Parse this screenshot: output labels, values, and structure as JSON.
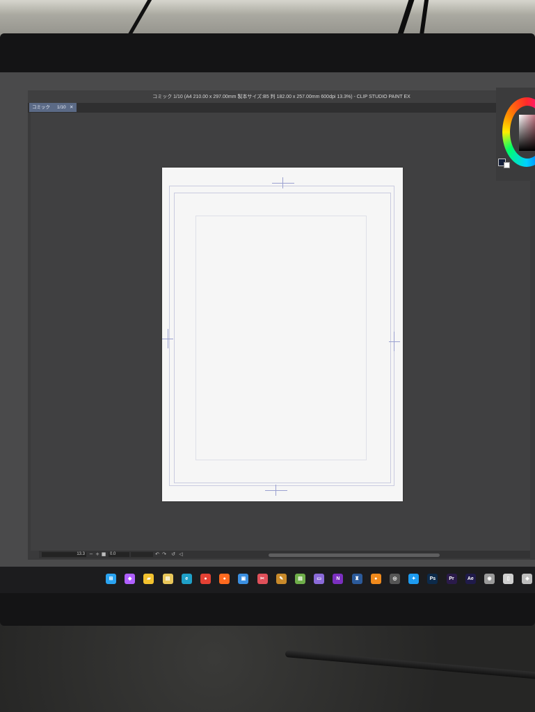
{
  "window": {
    "title": "コミック 1/10 (A4 210.00 x 297.00mm 製本サイズ:B5 判 182.00 x 257.00mm 600dpi 13.3%) - CLIP STUDIO PAINT EX"
  },
  "tab": {
    "name": "コミック",
    "page": "1/10",
    "close": "✕"
  },
  "statusbar": {
    "zoom": "13.3",
    "zoom_out": "−",
    "zoom_in": "+",
    "angle": "0.0"
  },
  "colors": {
    "main_color": "#15203a",
    "sub_color": "#ffffff"
  },
  "taskbar": {
    "icons": [
      {
        "name": "windows-start-icon",
        "glyph": "⊞",
        "color": "#2aa3f0"
      },
      {
        "name": "copilot-icon",
        "glyph": "◆",
        "color": "#b060ff"
      },
      {
        "name": "file-explorer-icon",
        "glyph": "▰",
        "color": "#f2c12e"
      },
      {
        "name": "sticky-notes-icon",
        "glyph": "▤",
        "color": "#e8c65a"
      },
      {
        "name": "edge-icon",
        "glyph": "e",
        "color": "#1fa0c8"
      },
      {
        "name": "chrome-icon",
        "glyph": "●",
        "color": "#e44134"
      },
      {
        "name": "firefox-icon",
        "glyph": "●",
        "color": "#ff6a1f"
      },
      {
        "name": "remote-desktop-icon",
        "glyph": "▣",
        "color": "#3b8fe0"
      },
      {
        "name": "snipping-tool-icon",
        "glyph": "✂",
        "color": "#e0505a"
      },
      {
        "name": "clip-studio-icon",
        "glyph": "✎",
        "color": "#c98a2a"
      },
      {
        "name": "notepad-icon",
        "glyph": "▤",
        "color": "#6fae4a"
      },
      {
        "name": "display-icon",
        "glyph": "▭",
        "color": "#8a6ad8"
      },
      {
        "name": "onenote-icon",
        "glyph": "N",
        "color": "#7b2fbf"
      },
      {
        "name": "app-icon",
        "glyph": "♜",
        "color": "#2b5a9a"
      },
      {
        "name": "blender-icon",
        "glyph": "●",
        "color": "#f08a1c"
      },
      {
        "name": "obs-icon",
        "glyph": "◎",
        "color": "#555555"
      },
      {
        "name": "twitter-icon",
        "glyph": "✦",
        "color": "#1d9bf0"
      },
      {
        "name": "photoshop-icon",
        "glyph": "Ps",
        "color": "#0c2a4a"
      },
      {
        "name": "premiere-icon",
        "glyph": "Pr",
        "color": "#2a1a4a"
      },
      {
        "name": "after-effects-icon",
        "glyph": "Ae",
        "color": "#1f1a4a"
      },
      {
        "name": "eye-app-icon",
        "glyph": "◉",
        "color": "#9a9a9a"
      },
      {
        "name": "book-icon",
        "glyph": "▯",
        "color": "#cfcfcf"
      },
      {
        "name": "settings-app-icon",
        "glyph": "◈",
        "color": "#bdbdbd"
      }
    ]
  }
}
